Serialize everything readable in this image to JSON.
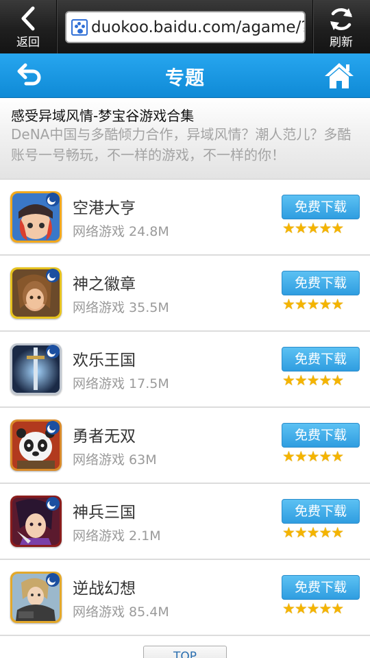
{
  "browser": {
    "back_label": "返回",
    "refresh_label": "刷新",
    "url": "duokoo.baidu.com/agame/?."
  },
  "header": {
    "title": "专题"
  },
  "intro": {
    "title": "感受异域风情-梦宝谷游戏合集",
    "description": "DeNA中国与多酷倾力合作，异域风情？潮人范儿？多酷账号一号畅玩，不一样的游戏，不一样的你！"
  },
  "games": [
    {
      "name": "空港大亨",
      "meta": "网络游戏 24.8M",
      "button": "免费下载",
      "rating": 5,
      "stars": "★★★★★"
    },
    {
      "name": "神之徽章",
      "meta": "网络游戏 35.5M",
      "button": "免费下载",
      "rating": 5,
      "stars": "★★★★★"
    },
    {
      "name": "欢乐王国",
      "meta": "网络游戏 17.5M",
      "button": "免费下载",
      "rating": 5,
      "stars": "★★★★★"
    },
    {
      "name": "勇者无双",
      "meta": "网络游戏 63M",
      "button": "免费下载",
      "rating": 5,
      "stars": "★★★★★"
    },
    {
      "name": "神兵三国",
      "meta": "网络游戏 2.1M",
      "button": "免费下载",
      "rating": 5,
      "stars": "★★★★★"
    },
    {
      "name": "逆战幻想",
      "meta": "网络游戏 85.4M",
      "button": "免费下载",
      "rating": 5,
      "stars": "★★★★★"
    }
  ],
  "footer": {
    "top_label": "TOP"
  },
  "colors": {
    "header_blue": "#1a96e0",
    "button_blue": "#3fa9e8",
    "star_gold": "#f4b400"
  }
}
